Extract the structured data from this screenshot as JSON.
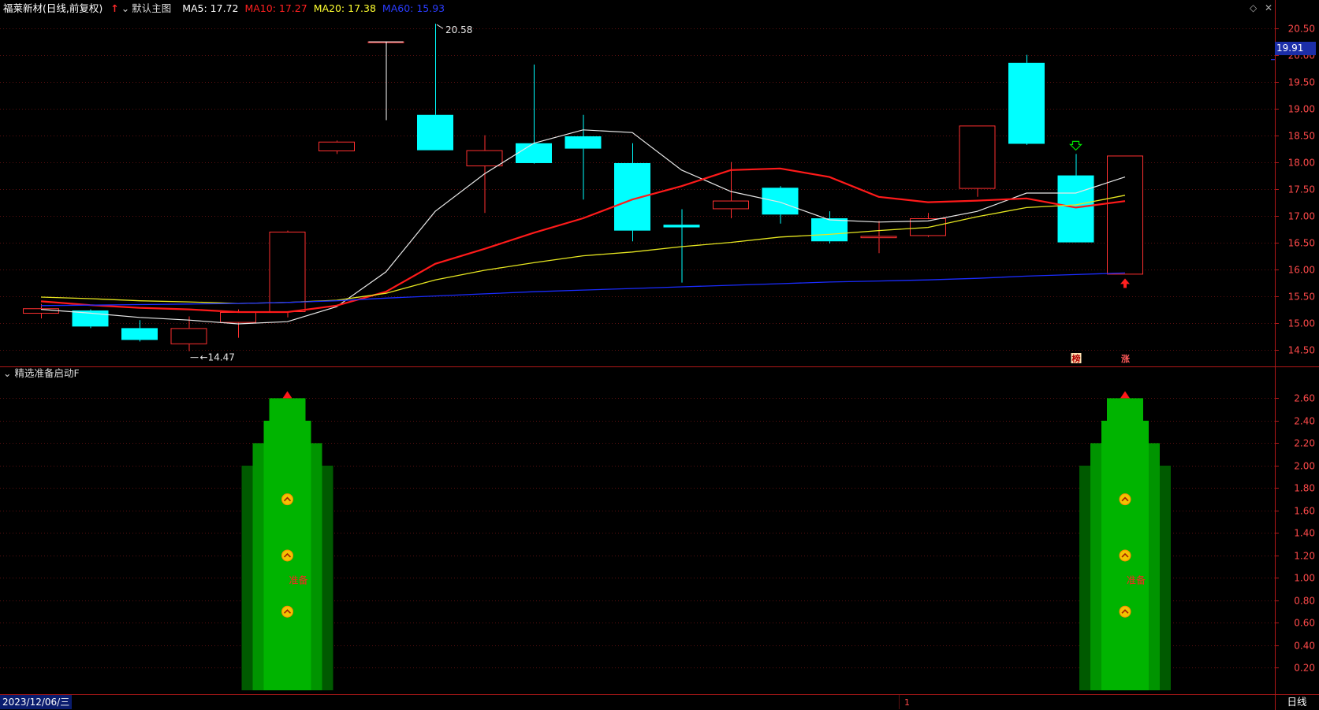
{
  "header": {
    "stock_name": "福莱新材",
    "period_mode": "(日线,前复权)",
    "template": "默认主图",
    "ma": [
      {
        "label": "MA5: 17.72",
        "color": "#ffffff"
      },
      {
        "label": "MA10: 17.27",
        "color": "#ff2020"
      },
      {
        "label": "MA20: 17.38",
        "color": "#ffff30"
      },
      {
        "label": "MA60: 15.93",
        "color": "#2a3cff"
      }
    ]
  },
  "indicator": {
    "name": "精选准备启动F",
    "signal_text": "准备"
  },
  "bottom": {
    "date": "2023/12/06/三",
    "period": "日线",
    "cursor_label": "1"
  },
  "last_price_label": "19.91",
  "badges": {
    "left": "榜",
    "right": "涨"
  },
  "colors": {
    "bg": "#000000",
    "grid": "#5a1010",
    "border": "#b01818",
    "up": "#ff3030",
    "down": "#00ffff",
    "axis_text": "#ff4a4a",
    "bar_dark": "#005a00",
    "bar_mid": "#009400",
    "bar_light": "#00b400"
  },
  "chart_data": [
    {
      "type": "candlestick",
      "title": "福莱新材 (日线,前复权)",
      "ylim": [
        14.2,
        20.7
      ],
      "y_ticks": [
        "20.50",
        "20.00",
        "19.50",
        "19.00",
        "18.50",
        "18.00",
        "17.50",
        "17.00",
        "16.50",
        "16.00",
        "15.50",
        "15.00",
        "14.50"
      ],
      "candles": [
        {
          "o": 15.17,
          "h": 15.35,
          "l": 15.08,
          "c": 15.27
        },
        {
          "o": 15.23,
          "h": 15.25,
          "l": 14.9,
          "c": 14.93
        },
        {
          "o": 14.9,
          "h": 15.05,
          "l": 14.65,
          "c": 14.68
        },
        {
          "o": 14.6,
          "h": 15.12,
          "l": 14.47,
          "c": 14.9
        },
        {
          "o": 15.0,
          "h": 15.25,
          "l": 14.72,
          "c": 15.2
        },
        {
          "o": 15.2,
          "h": 16.72,
          "l": 15.1,
          "c": 16.7
        },
        {
          "o": 18.2,
          "h": 18.4,
          "l": 18.15,
          "c": 18.38
        },
        {
          "o": 20.25,
          "h": 20.25,
          "l": 18.78,
          "c": 20.25
        },
        {
          "o": 18.88,
          "h": 20.58,
          "l": 18.22,
          "c": 18.22
        },
        {
          "o": 17.92,
          "h": 18.5,
          "l": 17.05,
          "c": 18.22
        },
        {
          "o": 18.35,
          "h": 19.82,
          "l": 17.97,
          "c": 17.98
        },
        {
          "o": 18.48,
          "h": 18.88,
          "l": 17.3,
          "c": 18.25
        },
        {
          "o": 17.98,
          "h": 18.35,
          "l": 16.52,
          "c": 16.72
        },
        {
          "o": 16.83,
          "h": 17.12,
          "l": 15.75,
          "c": 16.78
        },
        {
          "o": 17.12,
          "h": 18.0,
          "l": 16.95,
          "c": 17.28
        },
        {
          "o": 17.52,
          "h": 17.55,
          "l": 16.85,
          "c": 17.02
        },
        {
          "o": 16.95,
          "h": 17.08,
          "l": 16.48,
          "c": 16.52
        },
        {
          "o": 16.58,
          "h": 16.9,
          "l": 16.3,
          "c": 16.62
        },
        {
          "o": 16.62,
          "h": 17.05,
          "l": 16.6,
          "c": 16.95
        },
        {
          "o": 17.5,
          "h": 18.68,
          "l": 17.35,
          "c": 18.68
        },
        {
          "o": 19.85,
          "h": 20.0,
          "l": 18.32,
          "c": 18.34
        },
        {
          "o": 17.75,
          "h": 18.15,
          "l": 16.5,
          "c": 16.5
        },
        {
          "o": 15.9,
          "h": 18.12,
          "l": 15.9,
          "c": 18.12
        }
      ],
      "series": [
        {
          "name": "MA5",
          "values": [
            15.25,
            15.18,
            15.1,
            15.05,
            14.98,
            15.02,
            15.3,
            15.95,
            17.08,
            17.78,
            18.35,
            18.6,
            18.55,
            17.85,
            17.45,
            17.25,
            16.92,
            16.88,
            16.9,
            17.08,
            17.42,
            17.42,
            17.72
          ]
        },
        {
          "name": "MA10",
          "values": [
            15.4,
            15.33,
            15.28,
            15.25,
            15.2,
            15.2,
            15.32,
            15.58,
            16.1,
            16.38,
            16.68,
            16.95,
            17.3,
            17.55,
            17.85,
            17.88,
            17.72,
            17.35,
            17.25,
            17.28,
            17.32,
            17.15,
            17.27
          ]
        },
        {
          "name": "MA20",
          "values": [
            15.48,
            15.45,
            15.41,
            15.39,
            15.36,
            15.38,
            15.42,
            15.55,
            15.8,
            15.98,
            16.12,
            16.25,
            16.32,
            16.42,
            16.5,
            16.6,
            16.65,
            16.72,
            16.78,
            16.98,
            17.15,
            17.2,
            17.38
          ]
        },
        {
          "name": "MA60",
          "values": [
            15.32,
            15.33,
            15.34,
            15.35,
            15.36,
            15.38,
            15.41,
            15.46,
            15.5,
            15.54,
            15.58,
            15.61,
            15.64,
            15.67,
            15.7,
            15.73,
            15.76,
            15.78,
            15.8,
            15.83,
            15.87,
            15.9,
            15.93
          ]
        }
      ],
      "annotations": [
        {
          "text": "20.58",
          "candle": 8
        },
        {
          "text": "14.47",
          "candle": 3
        }
      ]
    },
    {
      "type": "bar",
      "title": "精选准备启动F",
      "ylim": [
        0,
        2.75
      ],
      "y_ticks": [
        "2.60",
        "2.40",
        "2.20",
        "2.00",
        "1.80",
        "1.60",
        "1.40",
        "1.20",
        "1.00",
        "0.80",
        "0.60",
        "0.40",
        "0.20"
      ],
      "signals": [
        {
          "candle": 5,
          "levels": [
            2.0,
            2.2,
            2.4,
            2.6
          ]
        },
        {
          "candle": 22,
          "levels": [
            2.0,
            2.2,
            2.4,
            2.6
          ]
        }
      ]
    }
  ]
}
